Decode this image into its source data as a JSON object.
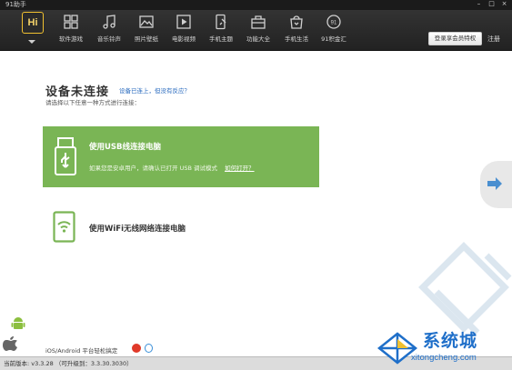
{
  "window": {
    "title": "91助手"
  },
  "toolbar": {
    "items": [
      {
        "label": "软件游戏",
        "icon": "grid-apps-icon"
      },
      {
        "label": "音乐铃声",
        "icon": "music-note-icon"
      },
      {
        "label": "照片壁纸",
        "icon": "picture-icon"
      },
      {
        "label": "电影视频",
        "icon": "play-video-icon"
      },
      {
        "label": "手机主题",
        "icon": "phone-brush-icon"
      },
      {
        "label": "功能大全",
        "icon": "toolbox-icon"
      },
      {
        "label": "手机生活",
        "icon": "shopping-bag-icon"
      },
      {
        "label": "91积金汇",
        "icon": "coin-icon"
      }
    ],
    "hi_label": "Hi",
    "login_label": "登录享会员特权",
    "register_label": "注册"
  },
  "main": {
    "heading": "设备未连接",
    "heading_link": "设备已连上，但没有反应？",
    "instruction": "请选择以下任意一种方式进行连接：",
    "usb_card": {
      "title": "使用USB线连接电脑",
      "desc": "如果您是安卓用户，请确认已打开 USB 调试模式",
      "link": "如何打开？"
    },
    "wifi_card": {
      "title": "使用WiFi无线网络连接电脑"
    }
  },
  "footer": {
    "platform_text": "iOS/Android 平台轻松搞定",
    "version_text": "当前版本: v3.3.28  （可升级到：3.3.30.3030）"
  },
  "watermark": {
    "text": "系统城",
    "domain": "xitongcheng.com"
  },
  "colors": {
    "accent_green": "#7ab555",
    "topbar": "#2b2b2b",
    "brand_blue": "#1f6fc9",
    "hi_yellow": "#f0c030"
  }
}
